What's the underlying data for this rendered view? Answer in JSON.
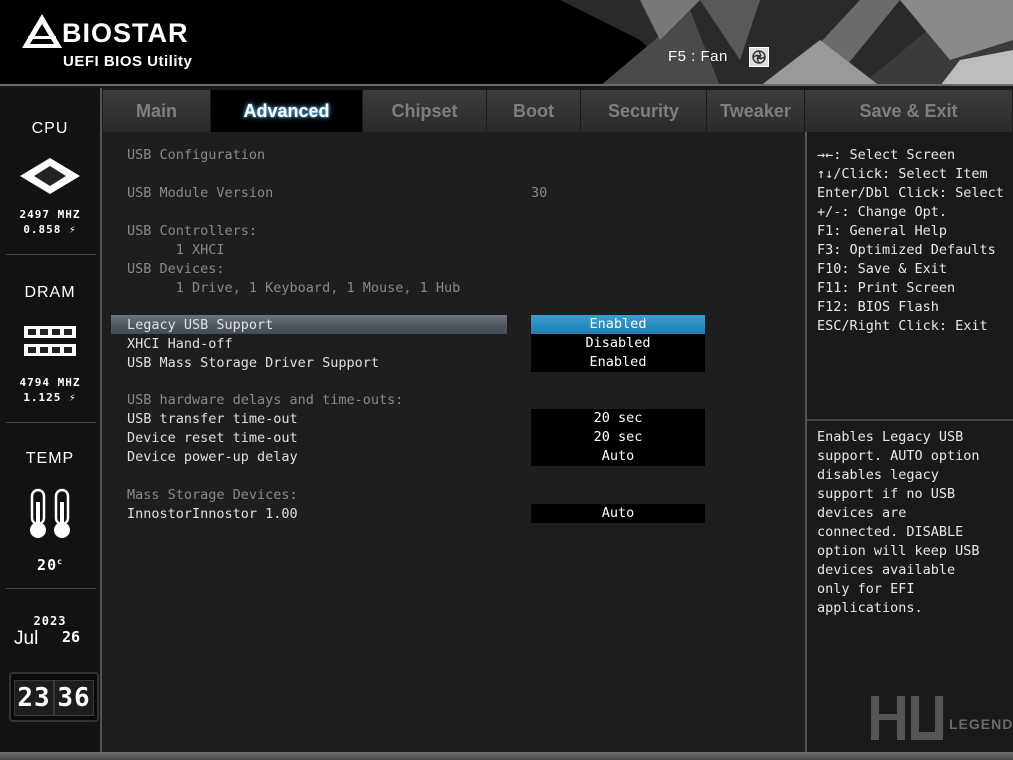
{
  "header": {
    "brand": "BIOSTAR",
    "subtitle": "UEFI BIOS Utility",
    "fan_label": "F5 : Fan"
  },
  "sidebar": {
    "cpu": {
      "title": "CPU",
      "freq": "2497 MHZ",
      "volt": "0.858"
    },
    "dram": {
      "title": "DRAM",
      "freq": "4794 MHZ",
      "volt": "1.125"
    },
    "temp": {
      "title": "TEMP",
      "value": "20",
      "unit": "c"
    },
    "date": {
      "year": "2023",
      "month": "Jul",
      "day": "26"
    },
    "clock": {
      "hour": "23",
      "minute": "36"
    }
  },
  "tabs": [
    "Main",
    "Advanced",
    "Chipset",
    "Boot",
    "Security",
    "Tweaker",
    "Save & Exit"
  ],
  "main": {
    "title": "USB Configuration",
    "module_version_label": "USB Module Version",
    "module_version_value": "30",
    "controllers_label": "USB Controllers:",
    "controllers_value": "      1 XHCI",
    "devices_label": "USB Devices:",
    "devices_value": "      1 Drive, 1 Keyboard, 1 Mouse, 1 Hub",
    "settings": [
      {
        "label": "Legacy USB Support",
        "value": "Enabled"
      },
      {
        "label": "XHCI Hand-off",
        "value": "Disabled"
      },
      {
        "label": "USB Mass Storage Driver Support",
        "value": "Enabled"
      }
    ],
    "delays_heading": "USB hardware delays and time-outs:",
    "delays": [
      {
        "label": "USB transfer time-out",
        "value": "20 sec"
      },
      {
        "label": "Device reset time-out",
        "value": "20 sec"
      },
      {
        "label": "Device power-up delay",
        "value": "Auto"
      }
    ],
    "mass_storage_heading": "Mass Storage Devices:",
    "mass_storage": [
      {
        "label": "InnostorInnostor 1.00",
        "value": "Auto"
      }
    ]
  },
  "help_keys": [
    "→←: Select Screen",
    "↑↓/Click: Select Item",
    "Enter/Dbl Click: Select",
    "+/-: Change Opt.",
    "F1: General Help",
    "F3: Optimized Defaults",
    "F10: Save & Exit",
    "F11: Print Screen",
    "F12: BIOS Flash",
    "ESC/Right Click: Exit"
  ],
  "help_text": [
    "Enables Legacy USB",
    "support. AUTO option",
    "disables legacy",
    "support if no USB",
    "devices are",
    "connected. DISABLE",
    "option will keep USB",
    "devices available",
    "only for EFI",
    "applications."
  ],
  "watermark": "LEGEND",
  "colors": {
    "accent": "#1c7db0",
    "selected_glow": "#4fb6ff"
  }
}
